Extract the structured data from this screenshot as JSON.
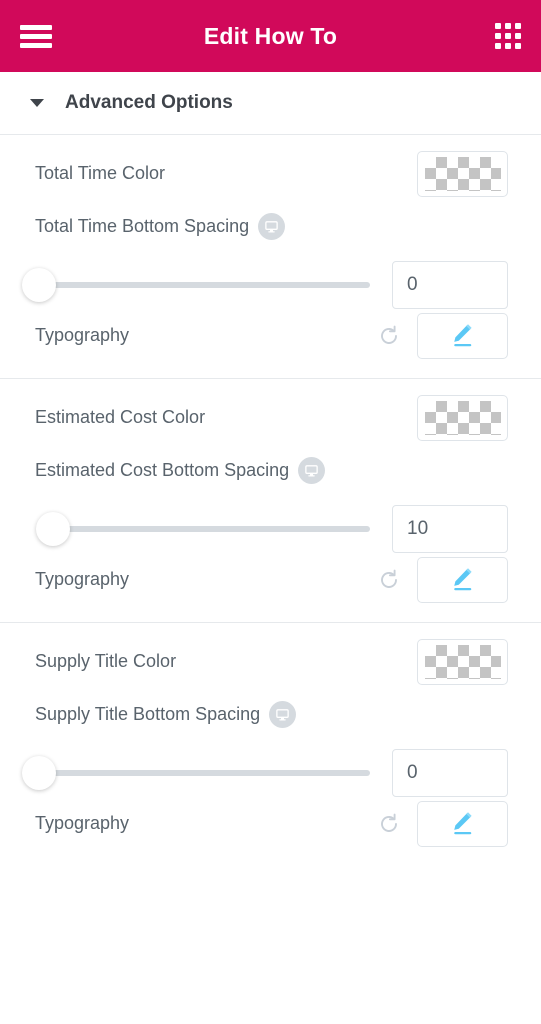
{
  "header": {
    "title": "Edit How To",
    "menu_icon": "hamburger-menu-icon",
    "apps_icon": "grid-apps-icon"
  },
  "section": {
    "title": "Advanced Options",
    "caret_icon": "chevron-down-icon",
    "expanded": true
  },
  "theme": {
    "accent": "#d1095a",
    "label_color": "#59636c",
    "title_color": "#3f444b",
    "border_color": "#e6e9ec",
    "pencil_blue": "#5bc8f5",
    "track_gray": "#d5dadf"
  },
  "groups": [
    {
      "color_label": "Total Time Color",
      "color_value": "transparent",
      "spacing_label": "Total Time Bottom Spacing",
      "device_icon": "desktop-monitor-icon",
      "spacing_value": "0",
      "spacing_percent": 0,
      "typography_label": "Typography",
      "reset_icon": "reset-circular-arrow-icon",
      "edit_icon": "pencil-edit-icon"
    },
    {
      "color_label": "Estimated Cost Color",
      "color_value": "transparent",
      "spacing_label": "Estimated Cost Bottom Spacing",
      "device_icon": "desktop-monitor-icon",
      "spacing_value": "10",
      "spacing_percent": 4,
      "typography_label": "Typography",
      "reset_icon": "reset-circular-arrow-icon",
      "edit_icon": "pencil-edit-icon"
    },
    {
      "color_label": "Supply Title Color",
      "color_value": "transparent",
      "spacing_label": "Supply Title Bottom Spacing",
      "device_icon": "desktop-monitor-icon",
      "spacing_value": "0",
      "spacing_percent": 0,
      "typography_label": "Typography",
      "reset_icon": "reset-circular-arrow-icon",
      "edit_icon": "pencil-edit-icon"
    }
  ]
}
